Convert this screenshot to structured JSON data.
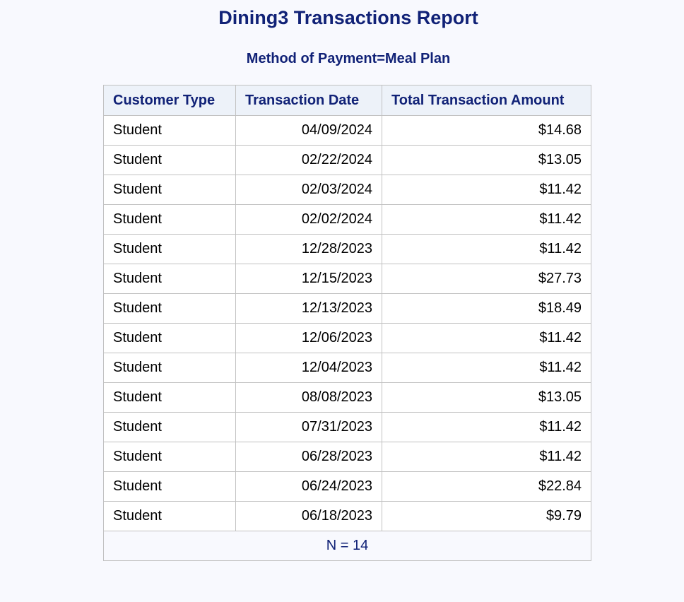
{
  "report": {
    "title": "Dining3 Transactions Report",
    "subtitle": "Method of Payment=Meal Plan"
  },
  "table": {
    "headers": [
      "Customer Type",
      "Transaction Date",
      "Total Transaction Amount"
    ],
    "rows": [
      [
        "Student",
        "04/09/2024",
        "$14.68"
      ],
      [
        "Student",
        "02/22/2024",
        "$13.05"
      ],
      [
        "Student",
        "02/03/2024",
        "$11.42"
      ],
      [
        "Student",
        "02/02/2024",
        "$11.42"
      ],
      [
        "Student",
        "12/28/2023",
        "$11.42"
      ],
      [
        "Student",
        "12/15/2023",
        "$27.73"
      ],
      [
        "Student",
        "12/13/2023",
        "$18.49"
      ],
      [
        "Student",
        "12/06/2023",
        "$11.42"
      ],
      [
        "Student",
        "12/04/2023",
        "$11.42"
      ],
      [
        "Student",
        "08/08/2023",
        "$13.05"
      ],
      [
        "Student",
        "07/31/2023",
        "$11.42"
      ],
      [
        "Student",
        "06/28/2023",
        "$11.42"
      ],
      [
        "Student",
        "06/24/2023",
        "$22.84"
      ],
      [
        "Student",
        "06/18/2023",
        "$9.79"
      ]
    ],
    "footer": "N = 14"
  },
  "colors": {
    "heading": "#112277",
    "header_bg": "#edf2f9",
    "page_bg": "#f8f9fe",
    "border": "#c1c1c1"
  }
}
